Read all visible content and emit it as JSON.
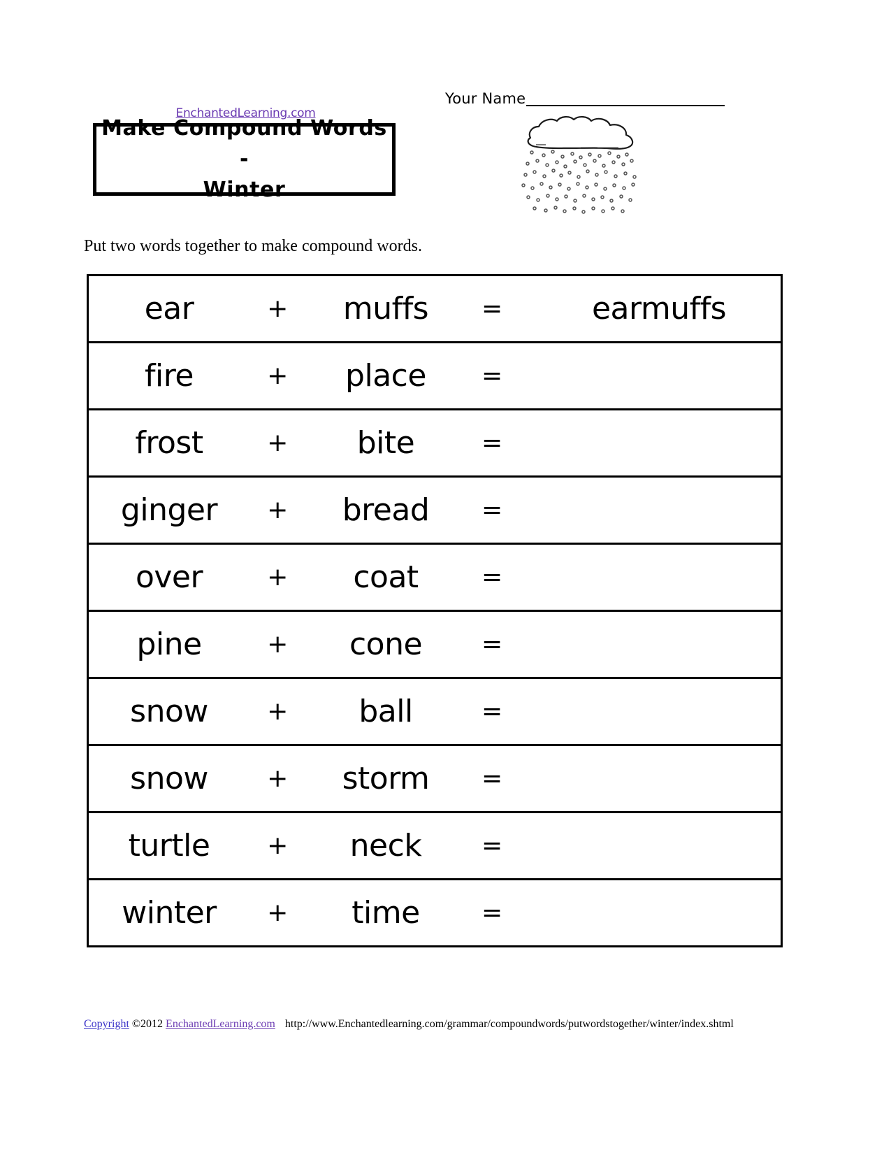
{
  "header": {
    "name_label": "Your Name",
    "name_value": "",
    "site_link": "EnchantedLearning.com",
    "title": "Make Compound Words -\nWinter",
    "cloud_icon": "snow-cloud-icon"
  },
  "instruction": "Put two words together to make compound words.",
  "table": {
    "operators": {
      "plus": "+",
      "equals": "="
    },
    "rows": [
      {
        "word1": "ear",
        "op": "+",
        "word2": "muffs",
        "eq": "=",
        "answer": "earmuffs"
      },
      {
        "word1": "fire",
        "op": "+",
        "word2": "place",
        "eq": "=",
        "answer": ""
      },
      {
        "word1": "frost",
        "op": "+",
        "word2": "bite",
        "eq": "=",
        "answer": ""
      },
      {
        "word1": "ginger",
        "op": "+",
        "word2": "bread",
        "eq": "=",
        "answer": ""
      },
      {
        "word1": "over",
        "op": "+",
        "word2": "coat",
        "eq": "=",
        "answer": ""
      },
      {
        "word1": "pine",
        "op": "+",
        "word2": "cone",
        "eq": "=",
        "answer": ""
      },
      {
        "word1": "snow",
        "op": "+",
        "word2": "ball",
        "eq": "=",
        "answer": ""
      },
      {
        "word1": "snow",
        "op": "+",
        "word2": "storm",
        "eq": "=",
        "answer": ""
      },
      {
        "word1": "turtle",
        "op": "+",
        "word2": "neck",
        "eq": "=",
        "answer": ""
      },
      {
        "word1": "winter",
        "op": "+",
        "word2": "time",
        "eq": "=",
        "answer": ""
      }
    ]
  },
  "footer": {
    "copyright_link": "Copyright",
    "copyright_year": "©2012",
    "site_link": "EnchantedLearning.com",
    "url": "http://www.Enchantedlearning.com/grammar/compoundwords/putwordstogether/winter/index.shtml"
  },
  "colors": {
    "link_purple": "#6a3ab2",
    "link_blue": "#3a32c8",
    "ink": "#000000",
    "paper": "#ffffff"
  }
}
